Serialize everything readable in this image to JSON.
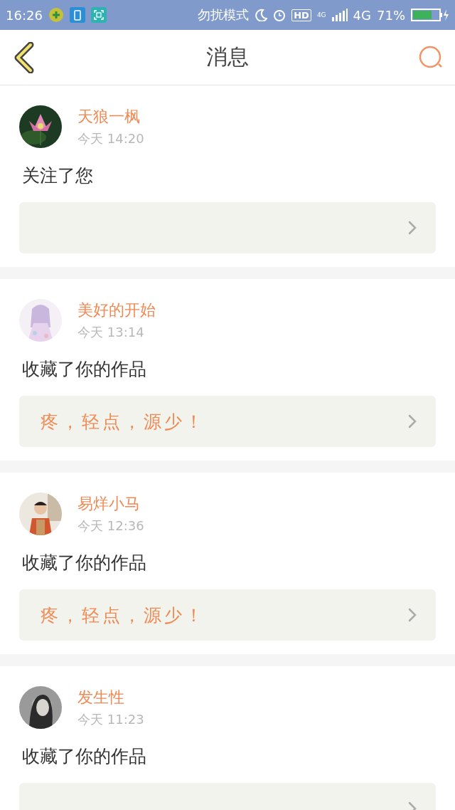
{
  "status_bar": {
    "time": "16:26",
    "mode": "勿扰模式",
    "hd": "HD",
    "network_small": "4G",
    "network": "4G",
    "battery": "71%"
  },
  "header": {
    "title": "消息"
  },
  "messages": [
    {
      "name": "天狼一枫",
      "time": "今天 14:20",
      "action": "关注了您"
    },
    {
      "name": "美好的开始",
      "time": "今天 13:14",
      "action": "收藏了你的作品",
      "quote": "疼，轻点，源少！"
    },
    {
      "name": "易烊小马",
      "time": "今天 12:36",
      "action": "收藏了你的作品",
      "quote": "疼，轻点，源少！"
    },
    {
      "name": "发生性",
      "time": "今天 11:23",
      "action": "收藏了你的作品"
    }
  ]
}
